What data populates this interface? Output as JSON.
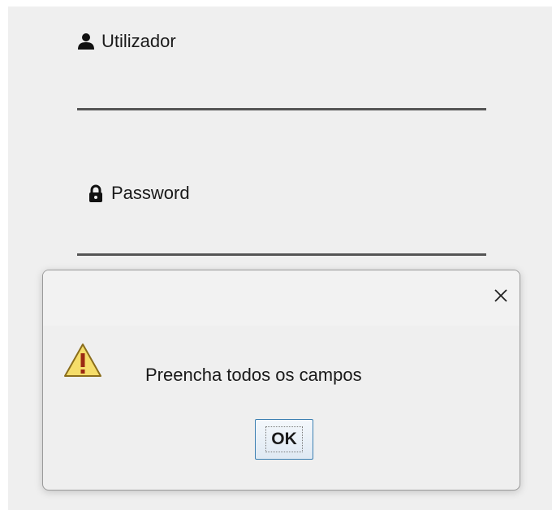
{
  "login_form": {
    "username_label": "Utilizador",
    "username_icon": "user-icon",
    "password_label": "Password",
    "password_icon": "lock-icon"
  },
  "dialog": {
    "close_icon": "close-icon",
    "warning_icon": "warning-icon",
    "message": "Preencha todos os campos",
    "ok_label": "OK"
  },
  "colors": {
    "background": "#efefef",
    "underline": "#555555",
    "warning_fill": "#f5dd6a",
    "ok_border": "#3c7fb1"
  }
}
